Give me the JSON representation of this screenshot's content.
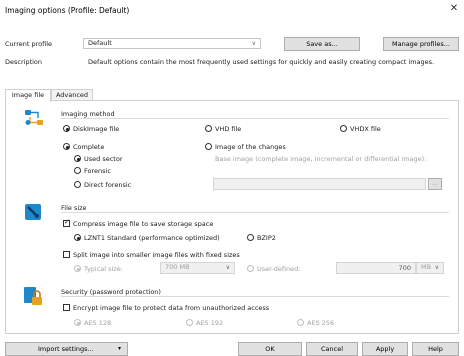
{
  "window": {
    "title": "Imaging options (Profile: Default)"
  },
  "profile": {
    "label": "Current profile",
    "value": "Default",
    "save_as": "Save as...",
    "manage": "Manage profiles..."
  },
  "description": {
    "label": "Description",
    "text": "Default options contain the most frequently used settings for quickly and easily creating compact images."
  },
  "tabs": [
    {
      "label": "Image file"
    },
    {
      "label": "Advanced"
    }
  ],
  "imaging_method": {
    "header": "Imaging method",
    "diskimage": "DiskImage file",
    "vhd": "VHD file",
    "vhdx": "VHDX file",
    "complete": "Complete",
    "changes": "Image of the changes",
    "base_image_hint": "Base image (complete image, incremental or differential image):",
    "used_sector": "Used sector",
    "forensic": "Forensic",
    "direct_forensic": "Direct forensic",
    "browse": "..."
  },
  "file_size": {
    "header": "File size",
    "compress": "Compress image file to save storage space",
    "lznt1": "LZNT1 Standard (performance optimized)",
    "bzip2": "BZIP2",
    "split": "Split image into smaller image files with fixed sizes",
    "typical": "Typical size:",
    "typical_value": "700 MB",
    "user_defined": "User-defined:",
    "user_value": "700",
    "user_unit": "MB"
  },
  "security": {
    "header": "Security (password protection)",
    "encrypt": "Encrypt image file to protect data from unauthorized access",
    "aes128": "AES 128",
    "aes192": "AES 192",
    "aes256": "AES 256"
  },
  "footer": {
    "import": "Import settings...",
    "ok": "OK",
    "cancel": "Cancel",
    "apply": "Apply",
    "help": "Help"
  },
  "colors": {
    "accent_blue": "#1e88c8",
    "icon_orange": "#e8a020"
  }
}
